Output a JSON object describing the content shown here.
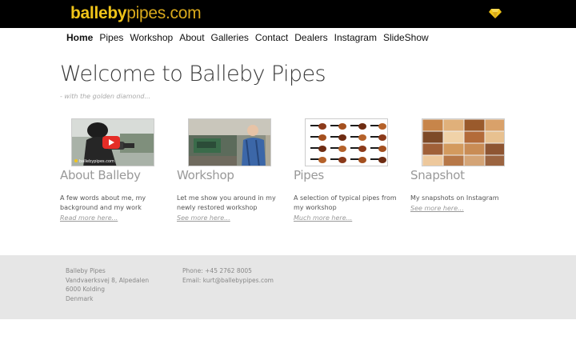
{
  "header": {
    "logo_bold": "balleby",
    "logo_rest": "pipes.com",
    "diamond_color": "#f0c419"
  },
  "nav": {
    "items": [
      "Home",
      "Pipes",
      "Workshop",
      "About",
      "Galleries",
      "Contact",
      "Dealers",
      "Instagram",
      "SlideShow"
    ],
    "active": "Home"
  },
  "main": {
    "title": "Welcome to Balleby Pipes",
    "tagline": "- with the golden diamond...",
    "cards": [
      {
        "title": "About Balleby",
        "text": "A few words about me, my background and my work",
        "link": "Read more here...",
        "thumb_icon": "video-thumbnail-icon",
        "thumb_caption": "ballebypipes.com"
      },
      {
        "title": "Workshop",
        "text": "Let me show you around in my newly restored workshop",
        "link": "See more here...",
        "thumb_icon": "workshop-photo-icon"
      },
      {
        "title": "Pipes",
        "text": "A selection of typical pipes from my workshop",
        "link": "Much more here...",
        "thumb_icon": "pipe-grid-icon"
      },
      {
        "title": "Snapshot",
        "text": "My snapshots on Instagram",
        "link": "See more here...",
        "thumb_icon": "instagram-collage-icon"
      }
    ]
  },
  "footer": {
    "address": [
      "Balleby Pipes",
      "Vandvaerksvej 8, Alpedalen",
      "6000 Kolding",
      "Denmark"
    ],
    "phone": "Phone: +45 2762 8005",
    "email": "Email: kurt@ballebypipes.com"
  }
}
